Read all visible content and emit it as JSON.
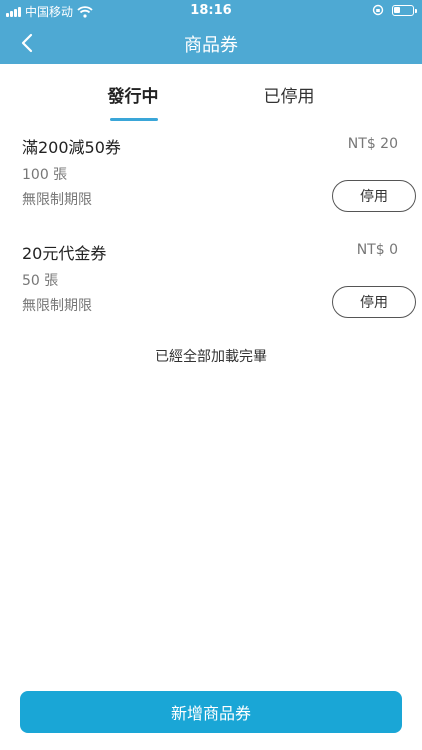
{
  "status_bar": {
    "carrier": "中国移动",
    "time": "18:16",
    "battery_level": 0.35
  },
  "nav": {
    "title": "商品券",
    "back_icon": "chevron-left-icon"
  },
  "tabs": [
    {
      "label": "發行中",
      "active": true
    },
    {
      "label": "已停用",
      "active": false
    }
  ],
  "coupons": [
    {
      "name": "滿200減50券",
      "price": "NT$ 20",
      "count": "100 張",
      "limit": "無限制期限",
      "action": "停用"
    },
    {
      "name": "20元代金券",
      "price": "NT$ 0",
      "count": "50 張",
      "limit": "無限制期限",
      "action": "停用"
    }
  ],
  "list_end_text": "已經全部加載完畢",
  "add_button": {
    "label": "新增商品券"
  },
  "colors": {
    "header": "#4ea9d3",
    "accent": "#3aa6d8",
    "primary_button": "#1aa6d6"
  }
}
